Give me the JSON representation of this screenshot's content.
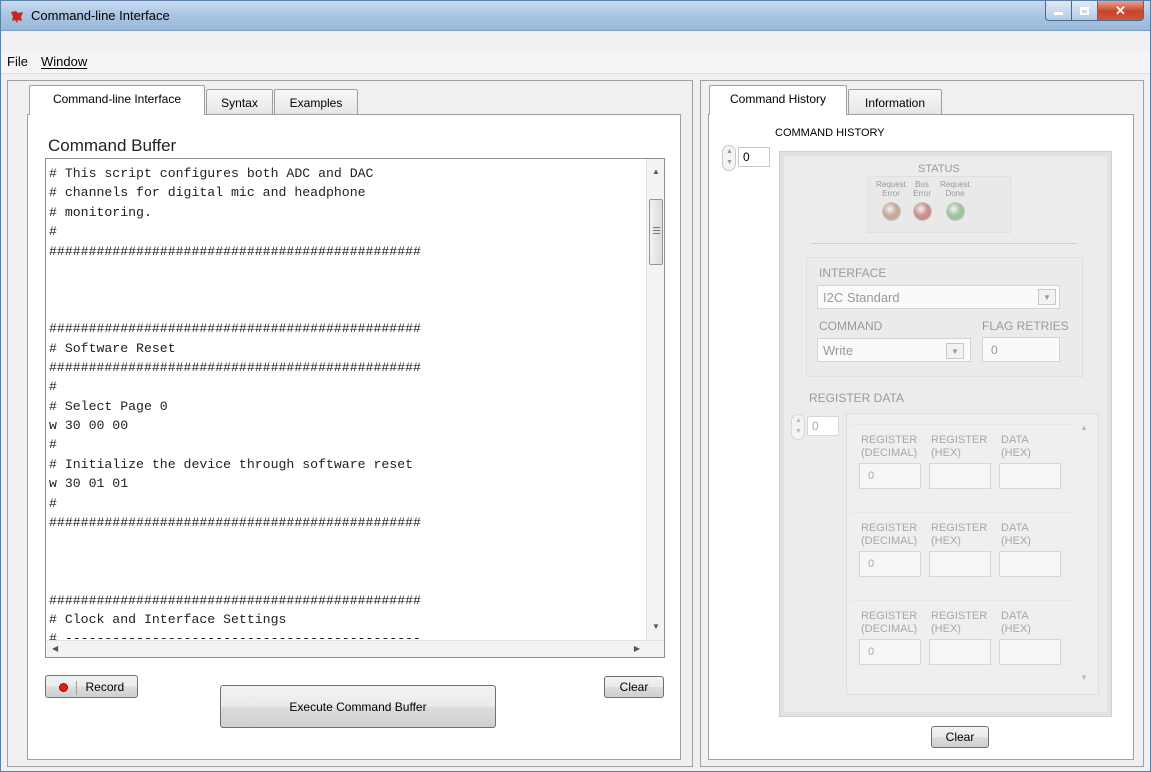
{
  "window": {
    "title": "Command-line Interface"
  },
  "menu": {
    "file": "File",
    "window": "Window"
  },
  "left_tabs": [
    "Command-line Interface",
    "Syntax",
    "Examples"
  ],
  "command_buffer": {
    "title": "Command Buffer",
    "lines": [
      "# This script configures both ADC and DAC",
      "# channels for digital mic and headphone",
      "# monitoring.",
      "#",
      "###############################################",
      "",
      "",
      "",
      "###############################################",
      "# Software Reset",
      "###############################################",
      "#",
      "# Select Page 0",
      "w 30 00 00",
      "#",
      "# Initialize the device through software reset",
      "w 30 01 01",
      "#",
      "###############################################",
      "",
      "",
      "",
      "###############################################",
      "# Clock and Interface Settings",
      "# ---------------------------------------------"
    ],
    "record_label": "Record",
    "execute_label": "Execute Command Buffer",
    "clear_label": "Clear"
  },
  "right_tabs": [
    "Command History",
    "Information"
  ],
  "history": {
    "heading": "COMMAND HISTORY",
    "index": "0",
    "status": {
      "heading": "STATUS",
      "leds": [
        {
          "label_1": "Request",
          "label_2": "Error",
          "color": "#c7a89a"
        },
        {
          "label_1": "Bus",
          "label_2": "Error",
          "color": "#c98f8f"
        },
        {
          "label_1": "Request",
          "label_2": "Done",
          "color": "#9fc29f"
        }
      ]
    },
    "interface_label": "INTERFACE",
    "interface_value": "I2C Standard",
    "command_label": "COMMAND",
    "command_value": "Write",
    "flag_retries_label": "FLAG RETRIES",
    "flag_retries_value": "0",
    "register_data_label": "REGISTER DATA",
    "register_index": "0",
    "register_col_1a": "REGISTER",
    "register_col_1b": "(DECIMAL)",
    "register_col_2a": "REGISTER",
    "register_col_2b": "(HEX)",
    "register_col_3a": "DATA",
    "register_col_3b": "(HEX)",
    "register_value": "0",
    "clear_label": "Clear"
  }
}
